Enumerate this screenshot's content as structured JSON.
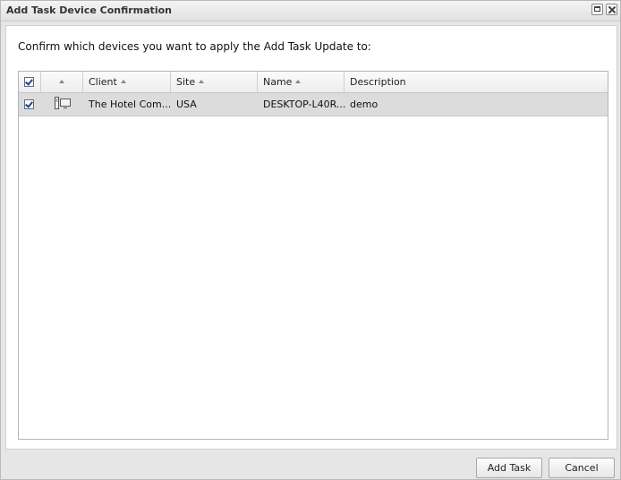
{
  "window": {
    "title": "Add Task Device Confirmation"
  },
  "prompt": "Confirm which devices you want to apply the Add Task Update to:",
  "grid": {
    "columns": [
      {
        "label": ""
      },
      {
        "label": ""
      },
      {
        "label": "Client"
      },
      {
        "label": "Site"
      },
      {
        "label": "Name"
      },
      {
        "label": "Description"
      }
    ],
    "rows": [
      {
        "checked": true,
        "icon": "desktop-icon",
        "client": "The Hotel Com...",
        "site": "USA",
        "name": "DESKTOP-L40R...",
        "description": "demo"
      }
    ]
  },
  "footer": {
    "add_task_label": "Add Task",
    "cancel_label": "Cancel"
  }
}
